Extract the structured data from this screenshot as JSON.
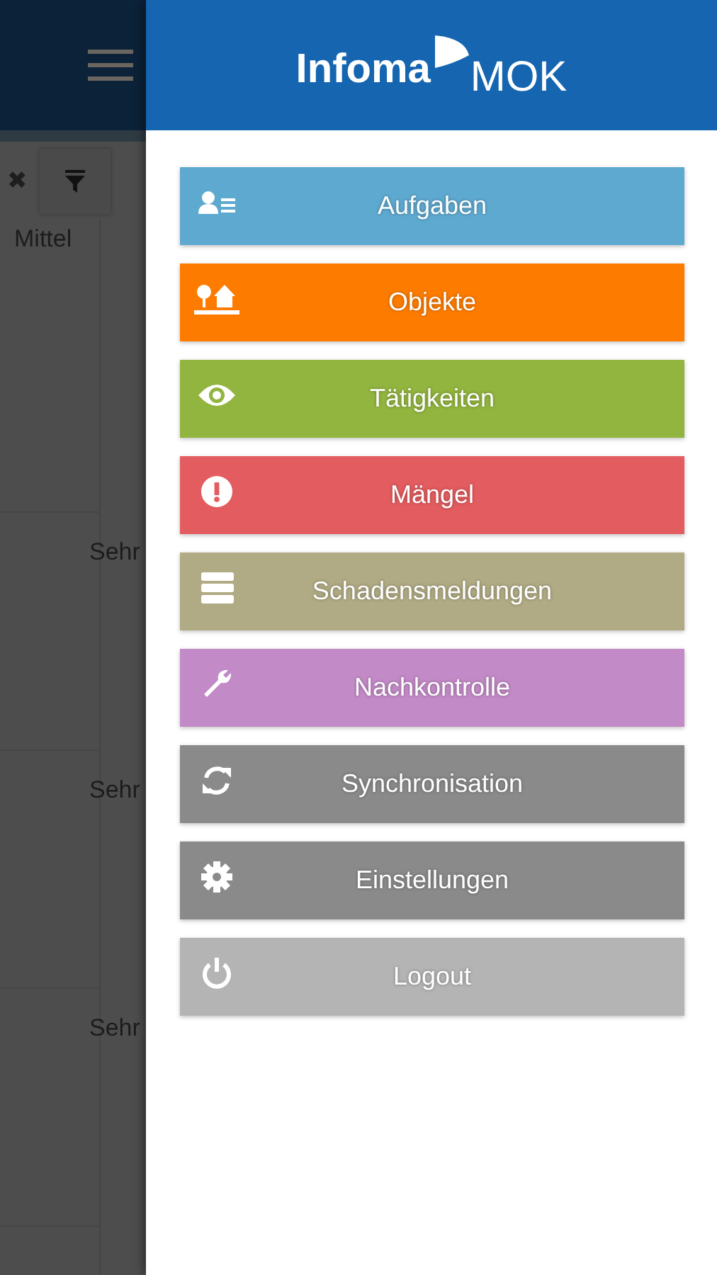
{
  "background_table": {
    "toolbar": {
      "clear": "✖"
    },
    "rows": [
      {
        "column_1": "Mittel"
      },
      {
        "column_2": "Sehr"
      },
      {
        "column_2": "Sehr"
      },
      {
        "column_2": "Sehr"
      }
    ]
  },
  "drawer": {
    "logo": {
      "brand": "Infoma",
      "product": "MOK"
    },
    "items": [
      {
        "label": "Aufgaben",
        "color": "#5ea9d0"
      },
      {
        "label": "Objekte",
        "color": "#fd7c00"
      },
      {
        "label": "Tätigkeiten",
        "color": "#92b53f"
      },
      {
        "label": "Mängel",
        "color": "#e35c5f"
      },
      {
        "label": "Schadensmeldungen",
        "color": "#b0ab84"
      },
      {
        "label": "Nachkontrolle",
        "color": "#c28ac6"
      },
      {
        "label": "Synchronisation",
        "color": "#8a8a8a"
      },
      {
        "label": "Einstellungen",
        "color": "#8a8a8a"
      },
      {
        "label": "Logout",
        "color": "#b4b4b4"
      }
    ]
  }
}
